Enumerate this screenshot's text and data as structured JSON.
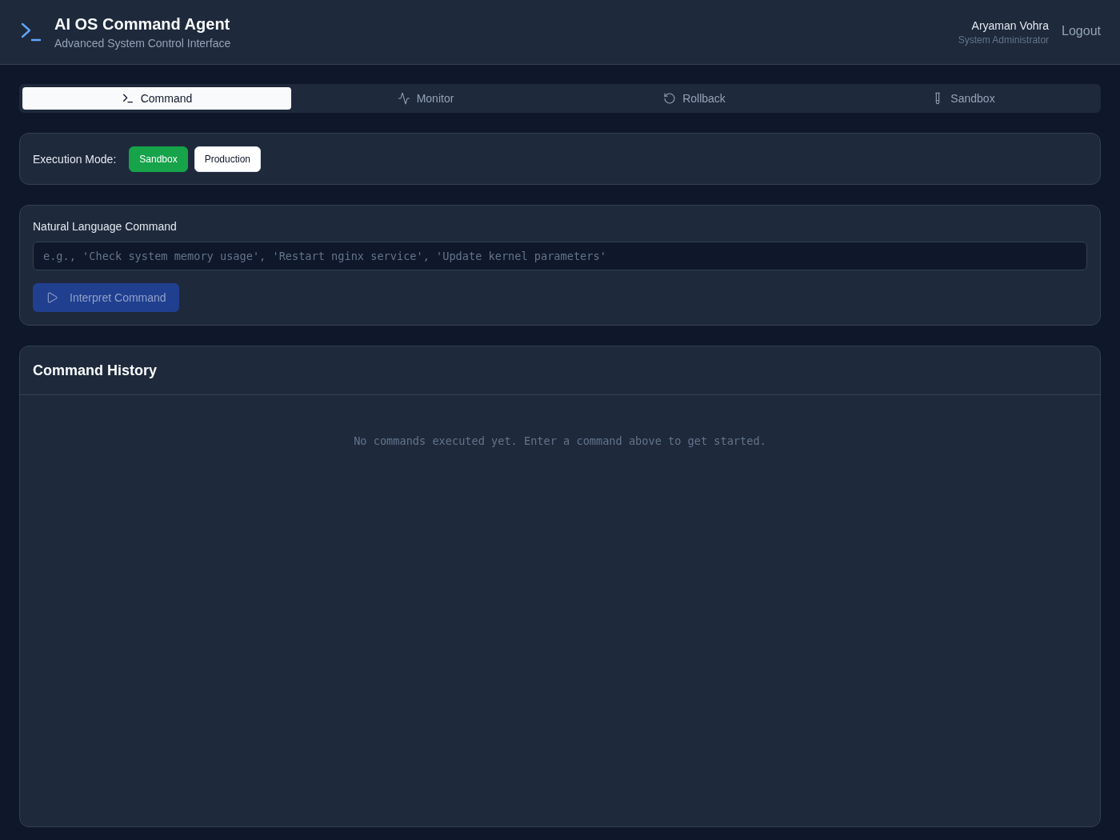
{
  "header": {
    "title": "AI OS Command Agent",
    "subtitle": "Advanced System Control Interface",
    "user": {
      "name": "Aryaman Vohra",
      "role": "System Administrator"
    },
    "logout": "Logout"
  },
  "tabs": [
    {
      "label": "Command",
      "kind": "terminal",
      "selected": true
    },
    {
      "label": "Monitor",
      "kind": "activity",
      "selected": false
    },
    {
      "label": "Rollback",
      "kind": "rotate",
      "selected": false
    },
    {
      "label": "Sandbox",
      "kind": "tube",
      "selected": false
    }
  ],
  "execution_mode": {
    "label": "Execution Mode:",
    "options": [
      {
        "label": "Sandbox",
        "selected": true
      },
      {
        "label": "Production",
        "selected": false
      }
    ]
  },
  "command_panel": {
    "label": "Natural Language Command",
    "placeholder": "e.g., 'Check system memory usage', 'Restart nginx service', 'Update kernel parameters'",
    "button": {
      "label": "Interpret Command",
      "disabled": true
    }
  },
  "history": {
    "title": "Command History",
    "empty_message": "No commands executed yet. Enter a command above to get started."
  }
}
